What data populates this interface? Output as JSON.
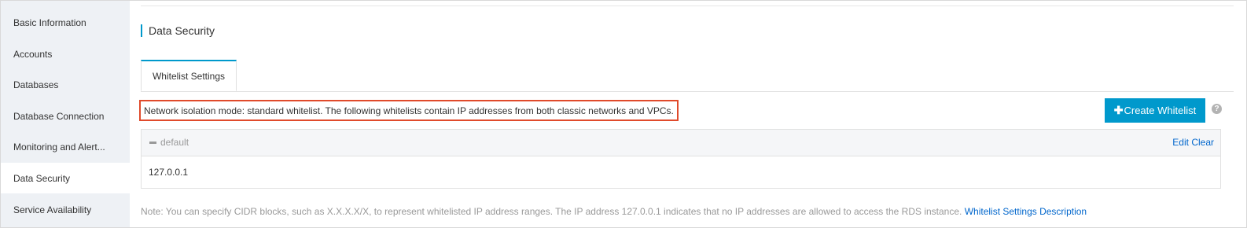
{
  "sidebar": {
    "items": [
      {
        "label": "Basic Information",
        "active": false
      },
      {
        "label": "Accounts",
        "active": false
      },
      {
        "label": "Databases",
        "active": false
      },
      {
        "label": "Database Connection",
        "active": false
      },
      {
        "label": "Monitoring and Alert...",
        "active": false
      },
      {
        "label": "Data Security",
        "active": true
      },
      {
        "label": "Service Availability",
        "active": false
      }
    ]
  },
  "main": {
    "section_title": "Data Security",
    "tabs": [
      {
        "label": "Whitelist Settings",
        "active": true
      }
    ],
    "notice": "Network isolation mode: standard whitelist. The following whitelists contain IP addresses from both classic networks and VPCs.",
    "create_button": {
      "icon": "plus-icon",
      "label": "Create Whitelist"
    },
    "help_icon": "?",
    "whitelist": {
      "group_name": "default",
      "edit_label": "Edit",
      "clear_label": "Clear",
      "ips": [
        "127.0.0.1"
      ]
    },
    "note_text": "Note: You can specify CIDR blocks, such as X.X.X.X/X, to represent whitelisted IP address ranges. The IP address 127.0.0.1 indicates that no IP addresses are allowed to access the RDS instance.",
    "note_link": "Whitelist Settings Description"
  },
  "colors": {
    "accent": "#0099cc",
    "highlight_border": "#e04a2b",
    "link": "#0066cc",
    "sidebar_bg": "#eef1f5"
  }
}
